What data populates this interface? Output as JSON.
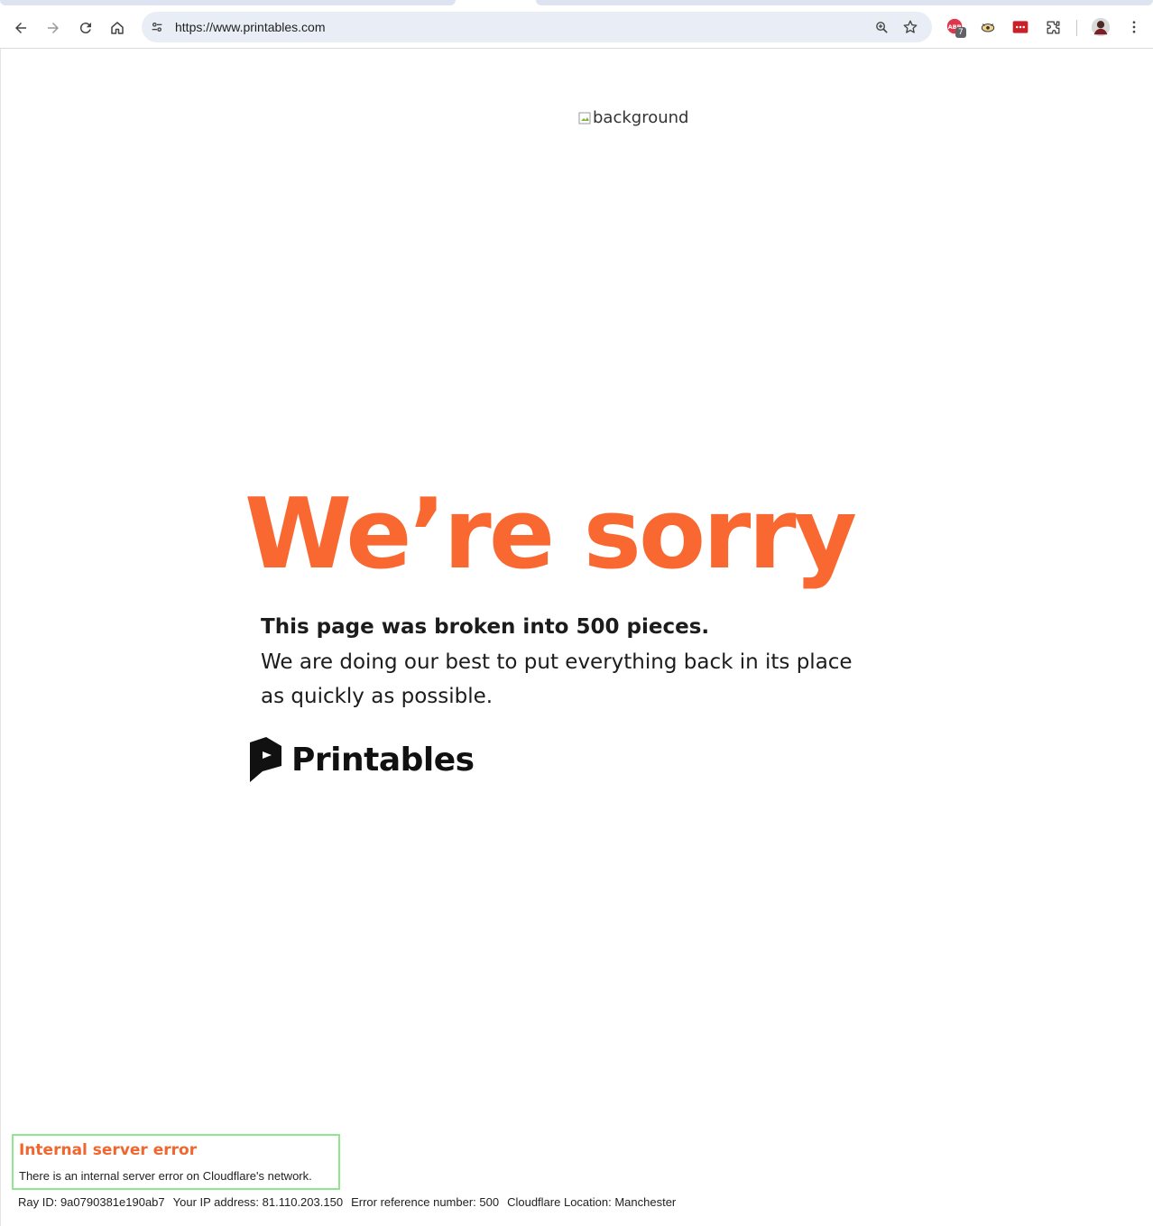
{
  "browser": {
    "url": "https://www.printables.com",
    "icons": {
      "back": "arrow-left-icon",
      "forward": "arrow-right-icon",
      "reload": "reload-icon",
      "home": "home-icon",
      "site_info": "tune-icon",
      "zoom": "zoom-icon",
      "bookmark": "star-icon",
      "extensions": "puzzle-icon",
      "menu": "kebab-menu-icon"
    },
    "extension_badge": "7"
  },
  "page": {
    "background_alt": "background",
    "headline": "We’re sorry",
    "message_bold": "This page was broken into 500 pieces.",
    "message_line1": "We are doing our best to put everything back in its place",
    "message_line2": "as quickly as possible.",
    "logo_text": "Printables",
    "colors": {
      "accent": "#fa6831",
      "text": "#1c1c1c"
    }
  },
  "cloudflare": {
    "title": "Internal server error",
    "description": "There is an internal server error on Cloudflare's network.",
    "ray_id": "Ray ID: 9a0790381e190ab7",
    "ip": "Your IP address: 81.110.203.150",
    "error_ref": "Error reference number: 500",
    "location": "Cloudflare Location: Manchester"
  }
}
